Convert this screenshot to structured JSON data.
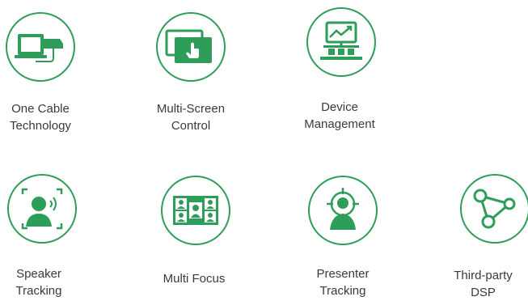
{
  "theme": {
    "accent": "#2e9d5a",
    "text": "#3a3a3a",
    "ring": "#2e9d5a"
  },
  "features": [
    {
      "icon": "one-cable-icon",
      "line1": "One Cable",
      "line2": "Technology"
    },
    {
      "icon": "multi-screen-icon",
      "line1": "Multi-Screen",
      "line2": "Control"
    },
    {
      "icon": "device-management-icon",
      "line1": "Device",
      "line2": "Management"
    },
    {
      "icon": "speaker-tracking-icon",
      "line1": "Speaker",
      "line2": "Tracking"
    },
    {
      "icon": "multi-focus-icon",
      "line1": "Multi Focus",
      "line2": ""
    },
    {
      "icon": "presenter-tracking-icon",
      "line1": "Presenter",
      "line2": "Tracking"
    },
    {
      "icon": "third-party-dsp-icon",
      "line1": "Third-party",
      "line2": "DSP"
    }
  ]
}
